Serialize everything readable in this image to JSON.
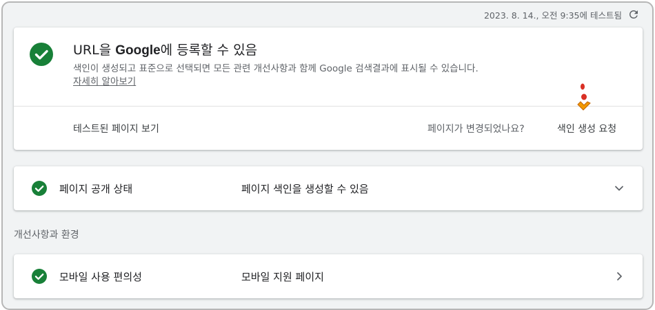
{
  "header": {
    "tested_text": "2023. 8. 14., 오전 9:35에 테스트됨",
    "refresh_icon": "refresh-icon"
  },
  "main_card": {
    "icon": "check-circle-icon",
    "title_prefix": "URL을 ",
    "title_brand": "Google",
    "title_suffix": "에 등록할 수 있음",
    "description": "색인이 생성되고 표준으로 선택되면 모든 관련 개선사항과 함께 Google 검색결과에 표시될 수 있습니다. ",
    "learn_more": "자세히 알아보기",
    "view_tested_page": "테스트된 페이지 보기",
    "page_changed_question": "페이지가 변경되었나요?",
    "request_indexing": "색인 생성 요청"
  },
  "rows": [
    {
      "label": "페이지 공개 상태",
      "value": "페이지 색인을 생성할 수 있음",
      "chevron": "chevron-down-icon"
    },
    {
      "label": "모바일 사용 편의성",
      "value": "모바일 지원 페이지",
      "chevron": "chevron-right-icon"
    }
  ],
  "section_label": "개선사항과 환경",
  "colors": {
    "success_green": "#188038",
    "text_primary": "#202124",
    "text_secondary": "#5f6368",
    "background": "#f1f3f4",
    "cursor_orange": "#f29900",
    "cursor_red": "#d93025"
  }
}
